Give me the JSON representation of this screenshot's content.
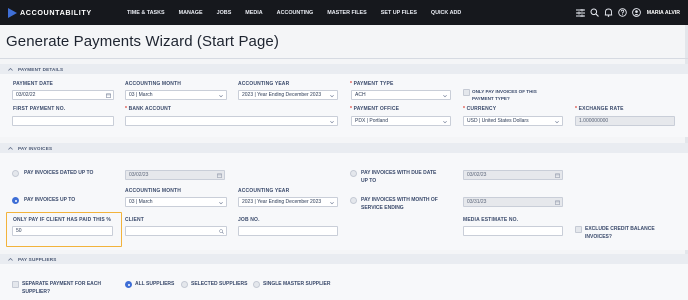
{
  "brand": {
    "name": "ACCOUNTABILITY"
  },
  "nav": {
    "items": [
      "TIME & TASKS",
      "MANAGE",
      "JOBS",
      "MEDIA",
      "ACCOUNTING",
      "MASTER FILES",
      "SET UP FILES",
      "QUICK ADD"
    ],
    "user": "MARIA ALVIR"
  },
  "page": {
    "title": "Generate Payments Wizard (Start Page)"
  },
  "sections": {
    "payment_details": "PAYMENT DETAILS",
    "pay_invoices": "PAY INVOICES",
    "pay_suppliers": "PAY SUPPLIERS"
  },
  "payment_details": {
    "payment_date_label": "PAYMENT DATE",
    "payment_date": "03/02/22",
    "accounting_month_label": "ACCOUNTING MONTH",
    "accounting_month": "03 | March",
    "accounting_year_label": "ACCOUNTING YEAR",
    "accounting_year": "2023 | Year Ending December 2023",
    "payment_type_label": "PAYMENT TYPE",
    "payment_type": "ACH",
    "only_pay_invoices_label_1": "ONLY PAY INVOICES OF THIS",
    "only_pay_invoices_label_2": "PAYMENT TYPE?",
    "first_payment_no_label": "FIRST PAYMENT NO.",
    "first_payment_no": "",
    "bank_account_label": "BANK ACCOUNT",
    "bank_account": "",
    "payment_office_label": "PAYMENT OFFICE",
    "payment_office": "PDX | Portland",
    "currency_label": "CURRENCY",
    "currency": "USD | United States Dollars",
    "exchange_rate_label": "EXCHANGE RATE",
    "exchange_rate": "1.000000000"
  },
  "pay_invoices": {
    "dated_up_to_label": "PAY INVOICES DATED UP TO",
    "dated_up_to_value": "03/02/23",
    "due_date_label_1": "PAY INVOICES WITH DUE DATE",
    "due_date_label_2": "UP TO",
    "due_date_value": "03/02/23",
    "up_to_label": "PAY INVOICES UP TO",
    "accounting_month_label": "ACCOUNTING MONTH",
    "accounting_month": "03 | March",
    "accounting_year_label": "ACCOUNTING YEAR",
    "accounting_year": "2023 | Year Ending December 2023",
    "month_of_service_label_1": "PAY INVOICES WITH MONTH OF",
    "month_of_service_label_2": "SERVICE ENDING",
    "month_of_service_value": "03/31/23",
    "only_pay_label": "ONLY PAY IF CLIENT HAS PAID THIS %",
    "only_pay_value": "50",
    "client_label": "CLIENT",
    "client": "",
    "job_no_label": "JOB NO.",
    "job_no": "",
    "media_estimate_label": "MEDIA ESTIMATE NO.",
    "media_estimate": "",
    "exclude_credit_label_1": "EXCLUDE CREDIT BALANCE",
    "exclude_credit_label_2": "INVOICES?"
  },
  "pay_suppliers": {
    "separate_label_1": "SEPARATE PAYMENT FOR EACH",
    "separate_label_2": "SUPPLIER?",
    "all_suppliers": "ALL SUPPLIERS",
    "selected_suppliers": "SELECTED SUPPLIERS",
    "single_master": "SINGLE MASTER SUPPLIER"
  },
  "colors": {
    "nav_bg": "#16181d",
    "accent": "#3f6fd6",
    "required": "#d9342b",
    "highlight": "#f2b33c"
  },
  "icons": [
    "list-icon",
    "search-icon",
    "bell-icon",
    "help-icon",
    "user-icon",
    "calendar-icon",
    "chevron-down-icon",
    "chevron-up-icon"
  ]
}
